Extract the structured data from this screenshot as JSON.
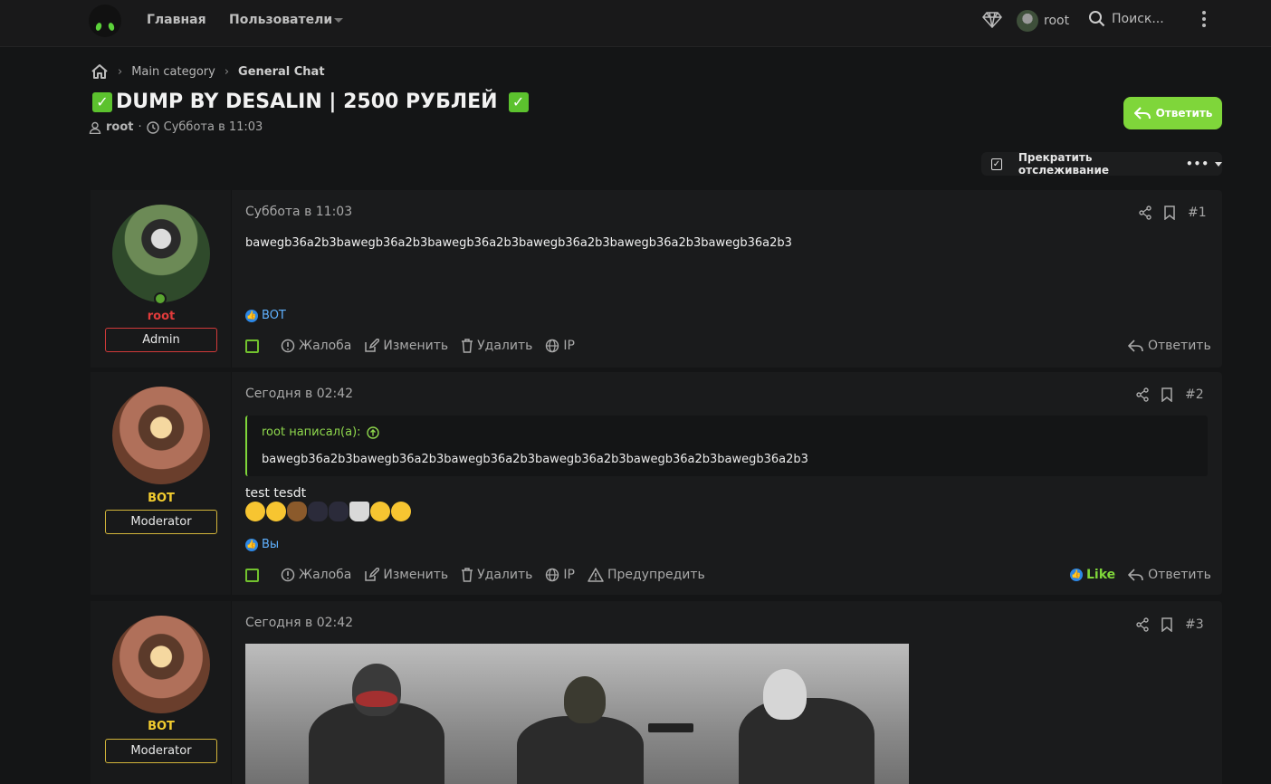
{
  "nav": {
    "home": "Главная",
    "users": "Пользователи",
    "username": "root",
    "search": "Поиск..."
  },
  "breadcrumb": {
    "items": [
      "Main category",
      "General Chat"
    ]
  },
  "thread": {
    "title": "DUMP BY DESALIN | 2500 РУБЛЕЙ",
    "title_emoji": "✓",
    "author": "root",
    "date": "Суббота в 11:03",
    "reply_button": "Ответить",
    "watch_label": "Прекратить отслеживание",
    "watch_more": "•••"
  },
  "colors": {
    "accent_green": "#7fd63a",
    "admin_red": "#e23b3b",
    "moderator_yellow": "#f2cc2f",
    "background": "#141516"
  },
  "posts": [
    {
      "number": "#1",
      "date": "Суббота в 11:03",
      "user": {
        "name": "root",
        "role": "Admin"
      },
      "body": "bawegb36a2b3bawegb36a2b3bawegb36a2b3bawegb36a2b3bawegb36a2b3bawegb36a2b3",
      "reactions": "BOT",
      "actions": [
        "Жалоба",
        "Изменить",
        "Удалить",
        "IP"
      ],
      "reply": "Ответить"
    },
    {
      "number": "#2",
      "date": "Сегодня в 02:42",
      "user": {
        "name": "BOT",
        "role": "Moderator"
      },
      "quote": {
        "author": "root написал(а):",
        "body": "bawegb36a2b3bawegb36a2b3bawegb36a2b3bawegb36a2b3bawegb36a2b3bawegb36a2b3"
      },
      "body": "test tesdt",
      "emojis": [
        "smile-emoji",
        "smile-emoji",
        "poop-emoji",
        "ninja-emoji",
        "ninja-emoji",
        "coffee-emoji",
        "kiss-emoji",
        "thinking-emoji"
      ],
      "reactions": "Вы",
      "actions": [
        "Жалоба",
        "Изменить",
        "Удалить",
        "IP",
        "Предупредить"
      ],
      "like": "Like",
      "reply": "Ответить"
    },
    {
      "number": "#3",
      "date": "Сегодня в 02:42",
      "user": {
        "name": "BOT",
        "role": "Moderator"
      }
    }
  ]
}
